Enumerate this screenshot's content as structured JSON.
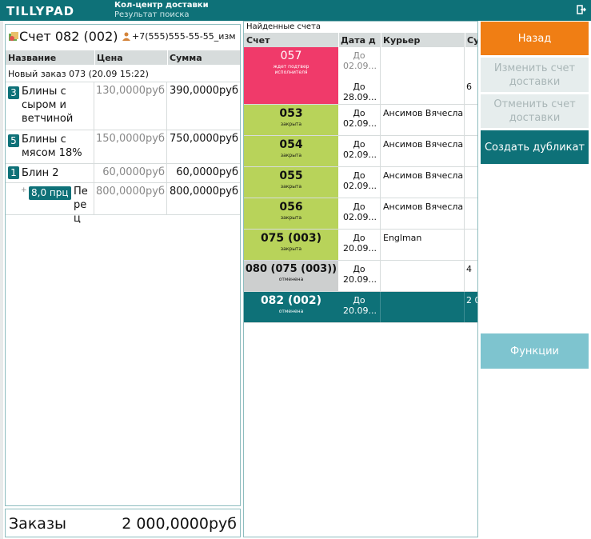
{
  "header": {
    "logo": "TILLYPAD",
    "title": "Кол-центр доставки",
    "subtitle": "Результат поиска"
  },
  "account": {
    "title": "Счет 082 (002)",
    "phone": "+7(555)555-55-55_изм",
    "columns": [
      "Название",
      "Цена",
      "Сумма"
    ],
    "order_line": "Новый заказ 073 (20.09 15:22)",
    "items": [
      {
        "qty": "3",
        "name": "Блины с сыром и ветчиной",
        "price": "130,0000руб",
        "sum": "390,0000руб"
      },
      {
        "qty": "5",
        "name": "Блины с мясом 18%",
        "price": "150,0000руб",
        "sum": "750,0000руб"
      },
      {
        "qty": "1",
        "name": "Блин 2",
        "price": "60,0000руб",
        "sum": "60,0000руб"
      }
    ],
    "modifier": {
      "badge": "8,0 прц",
      "name": "Перец",
      "price": "800,0000руб",
      "sum": "800,0000руб"
    },
    "footer_label": "Заказы",
    "footer_value": "2 000,0000руб"
  },
  "found": {
    "title": "Найденные счета",
    "columns": [
      "Счет",
      "Дата д",
      "Курьер",
      "Су"
    ],
    "rows": [
      {
        "num": "057",
        "status": "ждет подтвер исполнителя",
        "date1": "До 02.09...",
        "date2": "До 28.09...",
        "courier": "",
        "sum": "6"
      },
      {
        "num": "053",
        "status": "закрыта",
        "date1": "До 02.09...",
        "courier": "Ансимов Вячеслав",
        "sum": ""
      },
      {
        "num": "054",
        "status": "закрыта",
        "date1": "До 02.09...",
        "courier": "Ансимов Вячеслав",
        "sum": ""
      },
      {
        "num": "055",
        "status": "закрыта",
        "date1": "До 02.09...",
        "courier": "Ансимов Вячеслав",
        "sum": ""
      },
      {
        "num": "056",
        "status": "закрыта",
        "date1": "До 02.09...",
        "courier": "Ансимов Вячеслав",
        "sum": ""
      },
      {
        "num": "075 (003)",
        "status": "закрыта",
        "date1": "До 20.09...",
        "courier": "Englman",
        "sum": ""
      },
      {
        "num": "080 (075 (003))",
        "status": "отменена",
        "date1": "До 20.09...",
        "courier": "",
        "sum": "4"
      },
      {
        "num": "082 (002)",
        "status": "отменена",
        "date1": "До 20.09...",
        "courier": "",
        "sum": "2 0"
      }
    ]
  },
  "actions": {
    "back": "Назад",
    "edit": "Изменить счет доставки",
    "cancel": "Отменить счет доставки",
    "duplicate": "Создать дубликат",
    "functions": "Функции"
  },
  "colors": {
    "teal": "#0e7178",
    "orange": "#f07e14",
    "pink": "#f03a6a",
    "green": "#b8d35a",
    "gray": "#cdcfcf",
    "disabled": "#e6eded",
    "light_teal": "#7ec4cf"
  }
}
